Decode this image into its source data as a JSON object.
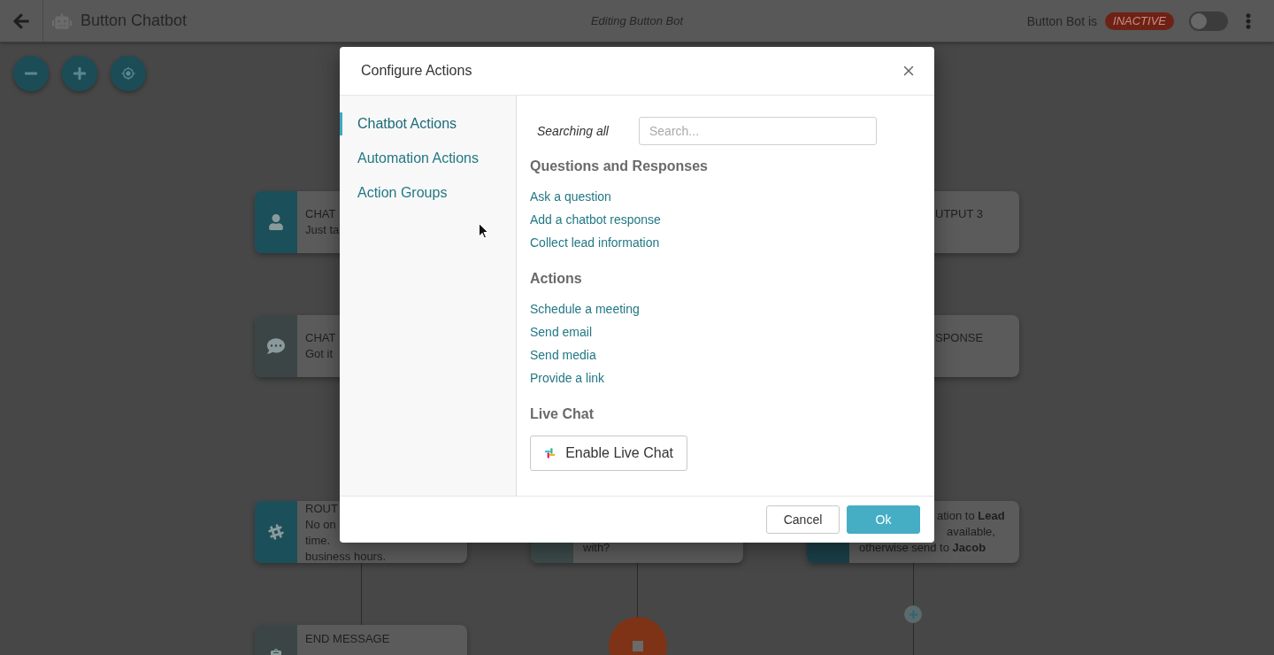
{
  "top_bar": {
    "title": "Button Chatbot",
    "subtitle": "Editing Button Bot",
    "status_label": "Button Bot is",
    "status_badge": "INACTIVE",
    "toggle": {
      "on": false
    }
  },
  "canvas": {
    "nodes": [
      {
        "lines": [
          "CHAT",
          "Just ta"
        ]
      },
      {
        "lines": [
          "UTPUT 3"
        ]
      },
      {
        "lines": [
          "CHAT",
          "Got it"
        ]
      },
      {
        "lines": [
          "SPONSE"
        ]
      },
      {
        "lines": [
          "ROUT",
          "No on",
          "time.",
          "business hours."
        ]
      },
      {
        "lines": [
          "with?"
        ]
      },
      {
        "lines": [
          "ation to **Lead**",
          "available,",
          "otherwise send to **Jacob**"
        ]
      },
      {
        "lines": [
          "END MESSAGE"
        ]
      }
    ]
  },
  "dialog": {
    "title": "Configure Actions",
    "nav": [
      {
        "label": "Chatbot Actions",
        "selected": true
      },
      {
        "label": "Automation Actions",
        "selected": false
      },
      {
        "label": "Action Groups",
        "selected": false
      }
    ],
    "search": {
      "label": "Searching all",
      "placeholder": "Search..."
    },
    "sections": [
      {
        "heading": "Questions and Responses",
        "items": [
          "Ask a question",
          "Add a chatbot response",
          "Collect lead information"
        ]
      },
      {
        "heading": "Actions",
        "items": [
          "Schedule a meeting",
          "Send email",
          "Send media",
          "Provide a link"
        ]
      },
      {
        "heading": "Live Chat",
        "button": "Enable Live Chat"
      }
    ],
    "buttons": [
      {
        "label": "Cancel",
        "kind": "secondary"
      },
      {
        "label": "Ok",
        "kind": "primary"
      }
    ]
  }
}
